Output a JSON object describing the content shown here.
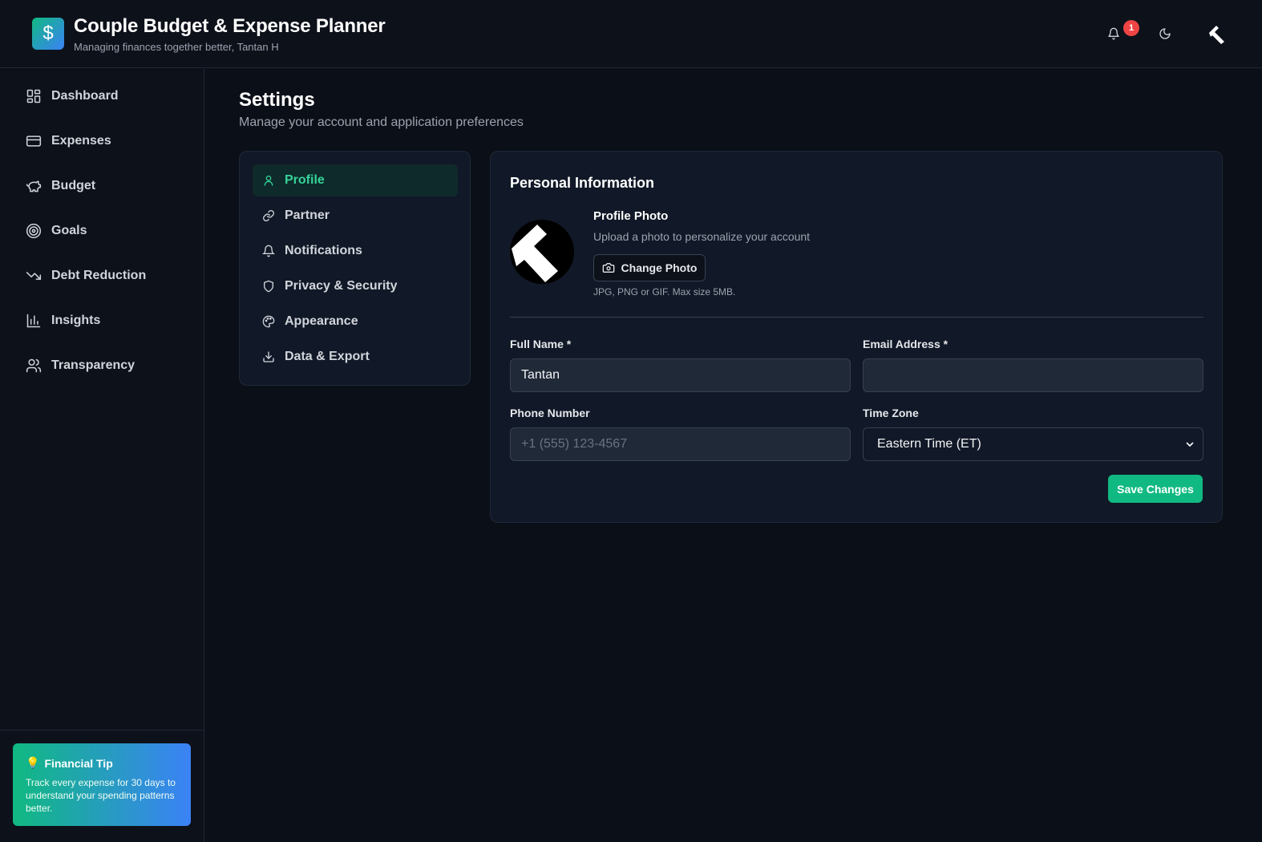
{
  "header": {
    "logo_symbol": "$",
    "title": "Couple Budget & Expense Planner",
    "subtitle": "Managing finances together better, Tantan H",
    "notification_count": "1",
    "icons": [
      "bell-icon",
      "moon-icon",
      "user-avatar"
    ]
  },
  "sidebar": {
    "items": [
      {
        "label": "Dashboard",
        "icon": "dashboard-icon"
      },
      {
        "label": "Expenses",
        "icon": "credit-card-icon"
      },
      {
        "label": "Budget",
        "icon": "piggy-bank-icon"
      },
      {
        "label": "Goals",
        "icon": "target-icon"
      },
      {
        "label": "Debt Reduction",
        "icon": "trending-down-icon"
      },
      {
        "label": "Insights",
        "icon": "bar-chart-icon"
      },
      {
        "label": "Transparency",
        "icon": "users-icon"
      }
    ],
    "tip": {
      "icon": "💡",
      "title": "Financial Tip",
      "text": "Track every expense for 30 days to understand your spending patterns better."
    }
  },
  "page": {
    "title": "Settings",
    "subtitle": "Manage your account and application preferences"
  },
  "settings_nav": {
    "items": [
      {
        "label": "Profile",
        "icon": "user-icon",
        "active": true
      },
      {
        "label": "Partner",
        "icon": "link-icon",
        "active": false
      },
      {
        "label": "Notifications",
        "icon": "bell-icon",
        "active": false
      },
      {
        "label": "Privacy & Security",
        "icon": "shield-icon",
        "active": false
      },
      {
        "label": "Appearance",
        "icon": "palette-icon",
        "active": false
      },
      {
        "label": "Data & Export",
        "icon": "download-icon",
        "active": false
      }
    ]
  },
  "profile": {
    "section_title": "Personal Information",
    "photo_title": "Profile Photo",
    "photo_desc": "Upload a photo to personalize your account",
    "change_photo_label": "Change Photo",
    "photo_hint": "JPG, PNG or GIF. Max size 5MB.",
    "full_name_label": "Full Name *",
    "full_name_value": "Tantan",
    "email_label": "Email Address *",
    "email_value": "",
    "phone_label": "Phone Number",
    "phone_placeholder": "+1 (555) 123-4567",
    "timezone_label": "Time Zone",
    "timezone_value": "Eastern Time (ET)",
    "save_label": "Save Changes"
  },
  "colors": {
    "accent": "#10b981",
    "accent_secondary": "#3b82f6",
    "background": "#0b0f17",
    "panel": "#111827",
    "badge": "#ef4444"
  }
}
